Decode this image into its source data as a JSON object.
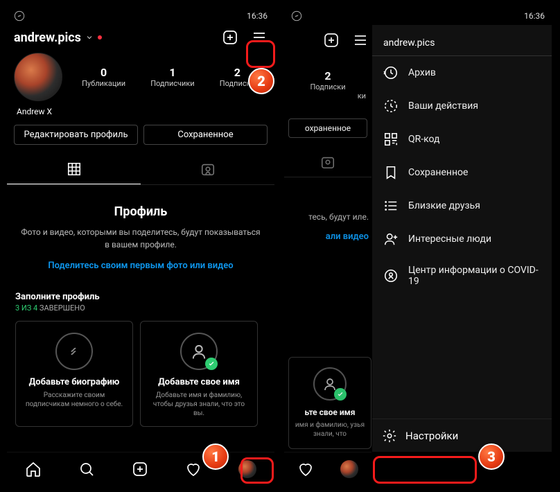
{
  "statusbar": {
    "time": "16:36"
  },
  "profile": {
    "username": "andrew.pics",
    "display_name": "Andrew X",
    "stats": {
      "posts_num": "0",
      "posts_lbl": "Публикации",
      "followers_num": "1",
      "followers_lbl": "Подписчики",
      "following_num": "2",
      "following_lbl": "Подписки"
    },
    "buttons": {
      "edit": "Редактировать профиль",
      "saved": "Сохраненное"
    },
    "empty": {
      "title": "Профиль",
      "desc": "Фото и видео, которыми вы поделитесь, будут показываться в вашем профиле.",
      "link": "Поделитесь своим первым фото или видео"
    },
    "complete": {
      "title": "Заполните профиль",
      "done": "3 ИЗ 4",
      "suffix": " ЗАВЕРШЕНО"
    },
    "cards": [
      {
        "title": "Добавьте биографию",
        "desc": "Расскажите своим подписчикам немного о себе."
      },
      {
        "title": "Добавьте свое имя",
        "desc": "Добавьте имя и фамилию, чтобы друзья знали, что это вы."
      }
    ]
  },
  "right": {
    "stats": {
      "following_num": "2",
      "following_lbl": "Подписки",
      "posts_suffix": "ки"
    },
    "saved_btn": "охраненное",
    "empty_desc_tail": "тесь, будут иле.",
    "empty_link_tail": "али видео",
    "card": {
      "title_tail": "ьте свое имя",
      "desc_tail": "имя и фамилию, узья знали, что"
    }
  },
  "menu": {
    "header": "andrew.pics",
    "items": {
      "archive": "Архив",
      "activity": "Ваши действия",
      "qr": "QR-код",
      "saved": "Сохраненное",
      "close_friends": "Близкие друзья",
      "discover": "Интересные люди",
      "covid": "Центр информации о COVID-19"
    },
    "settings": "Настройки"
  }
}
